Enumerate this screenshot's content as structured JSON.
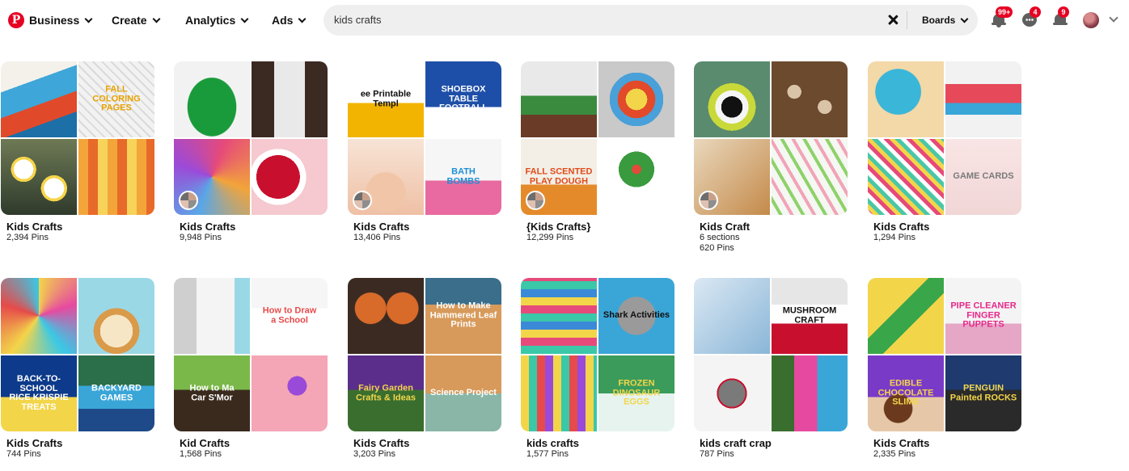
{
  "nav": {
    "logo_letter": "P",
    "items": [
      "Business",
      "Create",
      "Analytics",
      "Ads"
    ]
  },
  "search": {
    "query": "kids crafts",
    "scope": "Boards"
  },
  "badges": {
    "notifications": "99+",
    "messages": "4",
    "updates": "9"
  },
  "icons": {
    "notifications": "bell-icon",
    "messages": "chat-icon",
    "updates": "megaphone-icon",
    "clear": "close-icon",
    "account": "chevron-down-icon"
  },
  "colors": {
    "brand": "#e60023",
    "search_bg": "#efefef",
    "badge": "#e60023"
  },
  "boards": [
    {
      "title": "Kids Crafts",
      "meta": "2,394 Pins",
      "tiles": [
        {
          "bg": "linear-gradient(160deg,#f4f1ea 0 30%,#3ea6d8 30% 55%,#e04a2a 55% 75%,#1d6fa8 75%)",
          "caption": "",
          "color": "#fff"
        },
        {
          "bg": "repeating-linear-gradient(45deg,#f2f2f2 0 6px,#dadada 6px 8px)",
          "caption": "FALL\nCOLORING PAGES",
          "color": "#e8a200"
        },
        {
          "bg": "radial-gradient(circle at 30% 40%,#fff 0 14%,#f6d44a 14% 18%,transparent 18%),radial-gradient(circle at 70% 65%,#fff 0 14%,#f6d44a 14% 18%,transparent 18%),linear-gradient(#6e7a55,#2f3a2c)",
          "caption": "",
          "color": "#fff"
        },
        {
          "bg": "repeating-linear-gradient(90deg,#f3a53a 0 12px,#e86a2a 12px 24px,#f7d35a 24px 36px)",
          "caption": "",
          "color": "#fff"
        }
      ]
    },
    {
      "title": "Kids Crafts",
      "meta": "9,948 Pins",
      "collab": true,
      "tiles": [
        {
          "bg": "radial-gradient(ellipse at 50% 60%,#1a9b3b 0 45%,#f2f2f2 46%)",
          "caption": "",
          "color": "#fff"
        },
        {
          "bg": "linear-gradient(90deg,#3b2a22 0 30%,#e9e9e9 30% 70%,#3b2a22 70%)",
          "caption": "",
          "color": "#fff"
        },
        {
          "bg": "conic-gradient(from 20deg,#e64a7a,#f2a43a,#5aa7e6,#9c4ad8,#e64a7a)",
          "caption": "",
          "color": "#fff"
        },
        {
          "bg": "radial-gradient(circle at 35% 50%,#c8102e 0 35%,#fff 35% 45%,#f5c9cf 45%)",
          "caption": "",
          "color": "#fff"
        }
      ]
    },
    {
      "title": "Kids Crafts",
      "meta": "13,406 Pins",
      "collab": true,
      "tiles": [
        {
          "bg": "linear-gradient(#fff 0 55%,#f2b400 55%)",
          "caption": "ee Printable Templ",
          "color": "#111"
        },
        {
          "bg": "linear-gradient(#1e4fa8 0 60%,#fff 60%)",
          "caption": "SHOEBOX\nTABLE FOOTBALL",
          "color": "#fff"
        },
        {
          "bg": "radial-gradient(circle at 50% 70%,#f1c6a8 0 30%,transparent 31%),linear-gradient(#f7e4d6,#efc0a5)",
          "caption": "",
          "color": "#fff"
        },
        {
          "bg": "linear-gradient(#f6f6f6 0 55%,#e86aa0 55%)",
          "caption": "BATH\nBOMBS",
          "color": "#1b8fd8"
        }
      ]
    },
    {
      "title": "{Kids Crafts}",
      "meta": "12,299 Pins",
      "collab": true,
      "tiles": [
        {
          "bg": "linear-gradient(#e9e9e9 0 45%,#3a8b3e 45% 70%,#6a3b26 70%)",
          "caption": "",
          "color": "#fff"
        },
        {
          "bg": "radial-gradient(circle,#f3d54a 0 20%,#e24a2a 20% 35%,#4aa0d8 35% 50%,#c9c9c9 50%)",
          "caption": "",
          "color": "#fff"
        },
        {
          "bg": "linear-gradient(#f3efe6 0 60%,#e58a2a 60%)",
          "caption": "FALL SCENTED\nPLAY DOUGH",
          "color": "#e04a1a"
        },
        {
          "bg": "radial-gradient(circle at 50% 40%,#e24a3a 0 8%,#3a9b3e 8% 30%,#fff 30%)",
          "caption": "",
          "color": "#fff"
        }
      ]
    },
    {
      "title": "Kids Craft",
      "meta": "6 sections",
      "meta2": "620 Pins",
      "collab": true,
      "tiles": [
        {
          "bg": "radial-gradient(circle at 50% 60%,#111 0 18%,#f5f5f5 18% 28%,#c9d93a 28% 40%,#5a8b6e 40%)",
          "caption": "",
          "color": "#fff"
        },
        {
          "bg": "radial-gradient(circle at 30% 40%,#d9c4a8 0 10%,transparent 10%),radial-gradient(circle at 70% 60%,#d9c4a8 0 10%,transparent 10%),#6b4a2e",
          "caption": "",
          "color": "#fff"
        },
        {
          "bg": "linear-gradient(135deg,#e9d8bd,#c48a4a)",
          "caption": "",
          "color": "#fff"
        },
        {
          "bg": "repeating-linear-gradient(60deg,#f4f7f2 0 8px,#8fd16a 8px 12px,#f4f7f2 12px 20px,#f2a3b8 20px 24px)",
          "caption": "",
          "color": "#fff"
        }
      ]
    },
    {
      "title": "Kids Crafts",
      "meta": "1,294 Pins",
      "tiles": [
        {
          "bg": "radial-gradient(ellipse at 40% 40%,#3ab6d8 0 35%,#f3d8a8 36%)",
          "caption": "",
          "color": "#fff"
        },
        {
          "bg": "linear-gradient(#f2f2f2 0 30%,#e64a5a 30% 55%,#3aa6d8 55% 70%,#f2f2f2 70%)",
          "caption": "",
          "color": "#fff"
        },
        {
          "bg": "repeating-linear-gradient(45deg,#e64a7a 0 5px,#f3d54a 5px 10px,#4ac7a8 10px 15px,#fff 15px 20px)",
          "caption": "",
          "color": "#fff"
        },
        {
          "bg": "linear-gradient(#f9e5e5,#f1d6d6)",
          "caption": "GAME CARDS",
          "color": "#7a7a7a"
        }
      ]
    },
    {
      "title": "Kids Crafts",
      "meta": "744 Pins",
      "tiles": [
        {
          "bg": "conic-gradient(#f3d54a,#e64aa0,#3ac8e6,#f3d54a,#e64a4a,#3ac8e6)",
          "caption": "",
          "color": "#fff"
        },
        {
          "bg": "radial-gradient(circle at 50% 70%,#f6e6c6 0 25%,#d99a4a 25% 35%,#9ad8e6 35%)",
          "caption": "",
          "color": "#fff"
        },
        {
          "bg": "linear-gradient(#0d3a8a 0 55%,#f3d54a 55%)",
          "caption": "BACK-TO-SCHOOL\nRICE KRISPIE TREATS",
          "color": "#fff"
        },
        {
          "bg": "linear-gradient(#2a6e4a 0 40%,#3aa6d8 40% 70%,#1e4a8a 70%)",
          "caption": "BACKYARD GAMES",
          "color": "#fff"
        }
      ]
    },
    {
      "title": "Kid Crafts",
      "meta": "1,568 Pins",
      "tiles": [
        {
          "bg": "linear-gradient(90deg,#cfcfcf 0 30%,#f4f4f4 30% 80%,#9ad8e6 80%)",
          "caption": "",
          "color": "#fff"
        },
        {
          "bg": "linear-gradient(#f6f6f6 0 40%,#fff 40%)",
          "caption": "How to Draw\na School",
          "color": "#e64a4a"
        },
        {
          "bg": "linear-gradient(#7ab84a 0 45%,#3a2a1e 45%)",
          "caption": "How to Ma\nCar S'Mor",
          "color": "#fff"
        },
        {
          "bg": "radial-gradient(circle at 60% 40%,#9a4ad8 0 15%,#f4a6b6 15%)",
          "caption": "",
          "color": "#fff"
        }
      ]
    },
    {
      "title": "Kids Crafts",
      "meta": "3,203 Pins",
      "tiles": [
        {
          "bg": "radial-gradient(circle at 30% 40%,#d86a2a 0 22%,transparent 23%),radial-gradient(circle at 72% 40%,#d86a2a 0 22%,transparent 23%),#3a2a22",
          "caption": "",
          "color": "#fff"
        },
        {
          "bg": "linear-gradient(#3a6e8a 0 35%,#d89a5a 35%)",
          "caption": "How to Make\nHammered Leaf Prints",
          "color": "#fff"
        },
        {
          "bg": "linear-gradient(#5a2e8a 0 45%,#3a6e2e 45%)",
          "caption": "Fairy Garden\nCrafts & Ideas",
          "color": "#f3d54a"
        },
        {
          "bg": "linear-gradient(#d89a5a 0 50%,#8ab6a8 50%)",
          "caption": "Science Project",
          "color": "#fff"
        }
      ]
    },
    {
      "title": "kids crafts",
      "meta": "1,577 Pins",
      "tiles": [
        {
          "bg": "repeating-linear-gradient(0deg,#3ac8a8 0 10px,#e64a7a 10px 20px,#f3d54a 20px 30px,#3a8ad8 30px 40px)",
          "caption": "",
          "color": "#fff"
        },
        {
          "bg": "radial-gradient(ellipse at 50% 50%,#9a9a9a 0 35%,#3aa6d8 36%)",
          "caption": "Shark Activities",
          "color": "#111"
        },
        {
          "bg": "repeating-linear-gradient(90deg,#f3d54a 0 10px,#3ac8a8 10px 20px,#e64a4a 20px 30px,#9a4ad8 30px 40px)",
          "caption": "",
          "color": "#fff"
        },
        {
          "bg": "linear-gradient(#3a9b5a 0 50%,#e6f3ee 50%)",
          "caption": "FROZEN\nDINOSAUR EGGS",
          "color": "#f3d54a"
        }
      ]
    },
    {
      "title": "kids craft crap",
      "meta": "787 Pins",
      "tiles": [
        {
          "bg": "linear-gradient(135deg,#dbe8f3,#8ab6d8)",
          "caption": "",
          "color": "#fff"
        },
        {
          "bg": "linear-gradient(#e6e6e6 0 35%,#fff 35% 60%,#c8102e 60%)",
          "caption": "MUSHROOM CRAFT",
          "color": "#111"
        },
        {
          "bg": "radial-gradient(circle at 50% 50%,#7a7a7a 0 25%,#c8102e 25% 28%,#f4f4f4 28%)",
          "caption": "",
          "color": "#fff"
        },
        {
          "bg": "linear-gradient(90deg,#3a6e2e 0 30%,#e64aa0 30% 60%,#3aa6d8 60%)",
          "caption": "",
          "color": "#fff"
        }
      ]
    },
    {
      "title": "Kids Crafts",
      "meta": "2,335 Pins",
      "tiles": [
        {
          "bg": "linear-gradient(135deg,#f3d54a 0 40%,#3aa64a 40% 60%,#f3d54a 60%)",
          "caption": "",
          "color": "#fff"
        },
        {
          "bg": "linear-gradient(#f4f4f4 0 60%,#e6a6c6 60%)",
          "caption": "PIPE CLEANER\nFINGER PUPPETS",
          "color": "#e6288a"
        },
        {
          "bg": "radial-gradient(circle at 40% 70%,#6b3a1e 0 20%,transparent 21%),linear-gradient(#7a3ac8 0 55%,#e6c8a8 55%)",
          "caption": "EDIBLE\nCHOCOLATE\nSLIME",
          "color": "#f3d54a"
        },
        {
          "bg": "linear-gradient(#1e3a6e 0 45%,#2a2a2a 45%)",
          "caption": "PENGUIN\nPainted ROCKS",
          "color": "#f3d54a"
        }
      ]
    }
  ]
}
